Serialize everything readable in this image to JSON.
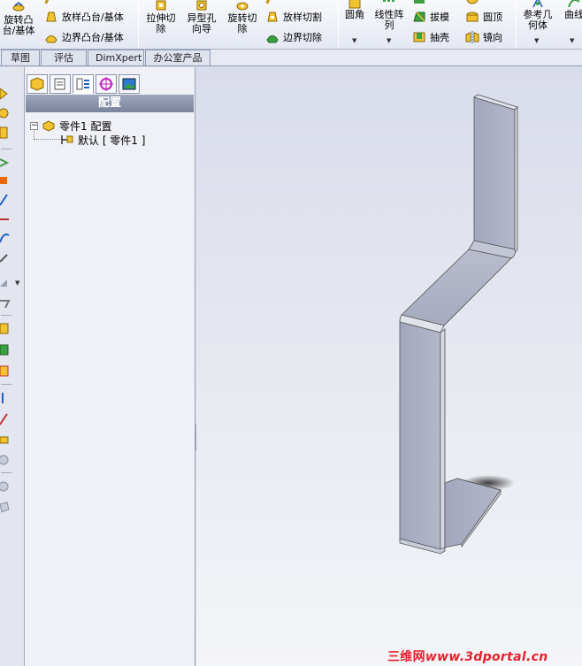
{
  "ribbon": {
    "revolve_boss": "旋转凸台/基体",
    "loft_boss": "放样凸台/基体",
    "boundary_boss": "边界凸台/基体",
    "extruded_cut": "拉伸切除",
    "hole_wizard": "异型孔向导",
    "revolved_cut": "旋转切除",
    "lofted_cut": "放样切割",
    "boundary_cut": "边界切除",
    "fillet": "圆角",
    "linear_pattern": "线性阵列",
    "draft": "拔模",
    "shell": "抽壳",
    "dome": "圆顶",
    "mirror": "镜向",
    "ref_geometry": "参考几何体",
    "curves": "曲线"
  },
  "tabs": [
    "草图",
    "评估",
    "DimXpert",
    "办公室产品"
  ],
  "panel": {
    "title": "配置",
    "tree_root": "零件1  配置",
    "tree_child": "默认  [ 零件1 ]"
  },
  "watermark": {
    "cn": "三维网",
    "url": "www.3dportal.cn"
  },
  "colors": {
    "accent_blue": "#1e5fc8",
    "panel_title": "#858da6",
    "model_face": "#a6abc0",
    "watermark": "#e8202c"
  }
}
